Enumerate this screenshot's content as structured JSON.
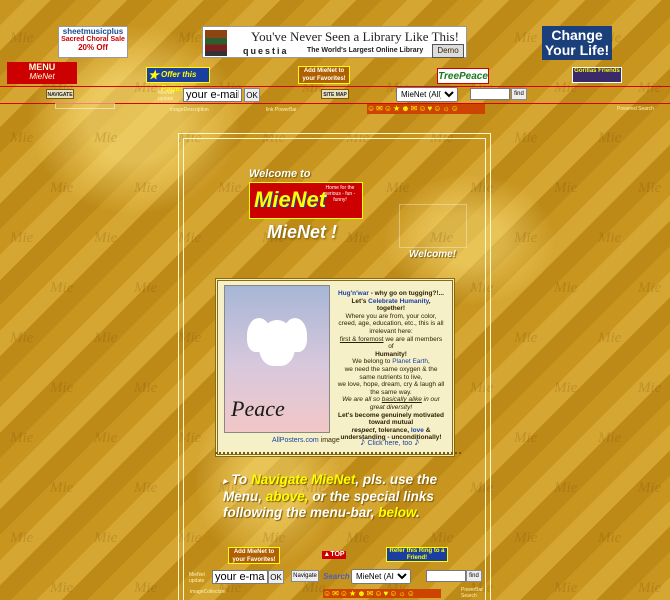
{
  "top_ads": {
    "sheetmusic": {
      "brand": "sheetmusicplus",
      "line1": "Sacred Choral Sale",
      "line2": "20% Off"
    },
    "questia": {
      "headline": "You've Never Seen a Library Like This!",
      "brand": "questia",
      "tagline": "The World's Largest Online Library",
      "button": "Demo"
    },
    "change": {
      "line1": "Change",
      "line2": "Your Life!"
    }
  },
  "nav_row": {
    "menu_title": "MENU",
    "menu_sub": "MieNet",
    "offer_badge": "Offer this Page!",
    "favorites_badge": "Add MieNet to your Favorites!",
    "treepeace": "TreePeace",
    "gorilla": "Gorillas Friends"
  },
  "toolbar": {
    "navigate": "NAVIGATE",
    "email_value": "your e-mail",
    "ok": "OK",
    "sitemap": "SITE MAP",
    "select_value": "MieNet (All)",
    "find": "find",
    "mienet_update": "MieNet update",
    "fine_print_1": "imageDescription",
    "fine_print_2": "link PowerBar",
    "fine_print_3": "Powered Search"
  },
  "main": {
    "welcome_to": "Welcome to",
    "logo_text": "MieNet",
    "logo_side": "Home for the serious - fun - funny!",
    "title": "MieNet !",
    "welcome_right": "Welcome!",
    "peace_word": "Peace",
    "credit_link": "AllPosters.com",
    "credit_text": "image",
    "hug_link": "Hug'n'war",
    "hug_text": "- why go on tugging?!...",
    "lets": "Let's",
    "celebrate_link": "Celebrate Humanity",
    "together": ", together!",
    "para1": "Where you are from, your color, creed, age, education, etc., this is all irrelevant here:",
    "first_foremost": "first & foremost",
    "para1b": "we are all members of",
    "humanity": "Humanity!",
    "belong_pre": "We belong to",
    "planet_earth": "Planet Earth",
    "para2": "we need the same oxygen & the same nutrients to live,",
    "para3": "we love, hope, dream, cry & laugh all the same way.",
    "para4_pre": "We are all so",
    "basically_alike": "basically alike",
    "para4_post": "in our great diversity!",
    "para5": "Let's become genuinely motivated toward mutual",
    "respect": "respect",
    "tolerance": "tolerance",
    "love": "love",
    "para5b": "understanding",
    "unconditional": "- unconditionally!",
    "click_here": "Click here, too",
    "navigate_pre": "To",
    "navigate_link": "Navigate MieNet",
    "navigate_mid": ", pls. use the Menu,",
    "above": "above,",
    "navigate_mid2": "or the special links following the menu-bar,",
    "below": "below",
    "period": "."
  },
  "bottom": {
    "favorites": "Add MieNet to your Favorites!",
    "top": "TOP",
    "refer": "Refer this Ring to a Friend!",
    "mienet_update": "MieNet update",
    "email_value": "your e-mail",
    "ok": "OK",
    "navigate": "Navigate",
    "search_label": "Search",
    "select_value": "MieNet (All)",
    "find": "find",
    "fine_print_1": "imageCollection",
    "fine_print_2": "PowerBar Search"
  },
  "colors": {
    "accent_red": "#cc0000",
    "gold": "#c9961f",
    "cream": "#fff3b0",
    "yellow_text": "#ffff00"
  }
}
